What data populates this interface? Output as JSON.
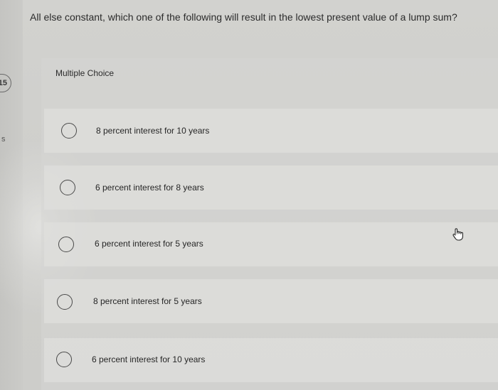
{
  "question": {
    "text": "All else constant, which one of the following will result in the lowest present value of a lump sum?"
  },
  "quiz": {
    "type_label": "Multiple Choice",
    "options": [
      {
        "label": "8 percent interest for 10 years"
      },
      {
        "label": "6 percent interest for 8 years"
      },
      {
        "label": "6 percent interest for 5 years"
      },
      {
        "label": "8 percent interest for 5 years"
      },
      {
        "label": "6 percent interest for 10 years"
      }
    ]
  },
  "sidebar": {
    "badge_text": "15",
    "letter": "s"
  },
  "icons": {
    "pointer": "hand-pointer-icon"
  },
  "colors": {
    "background": "#cfcfcc",
    "text": "#2b2b2b",
    "radio_border": "#4a4a4a"
  }
}
